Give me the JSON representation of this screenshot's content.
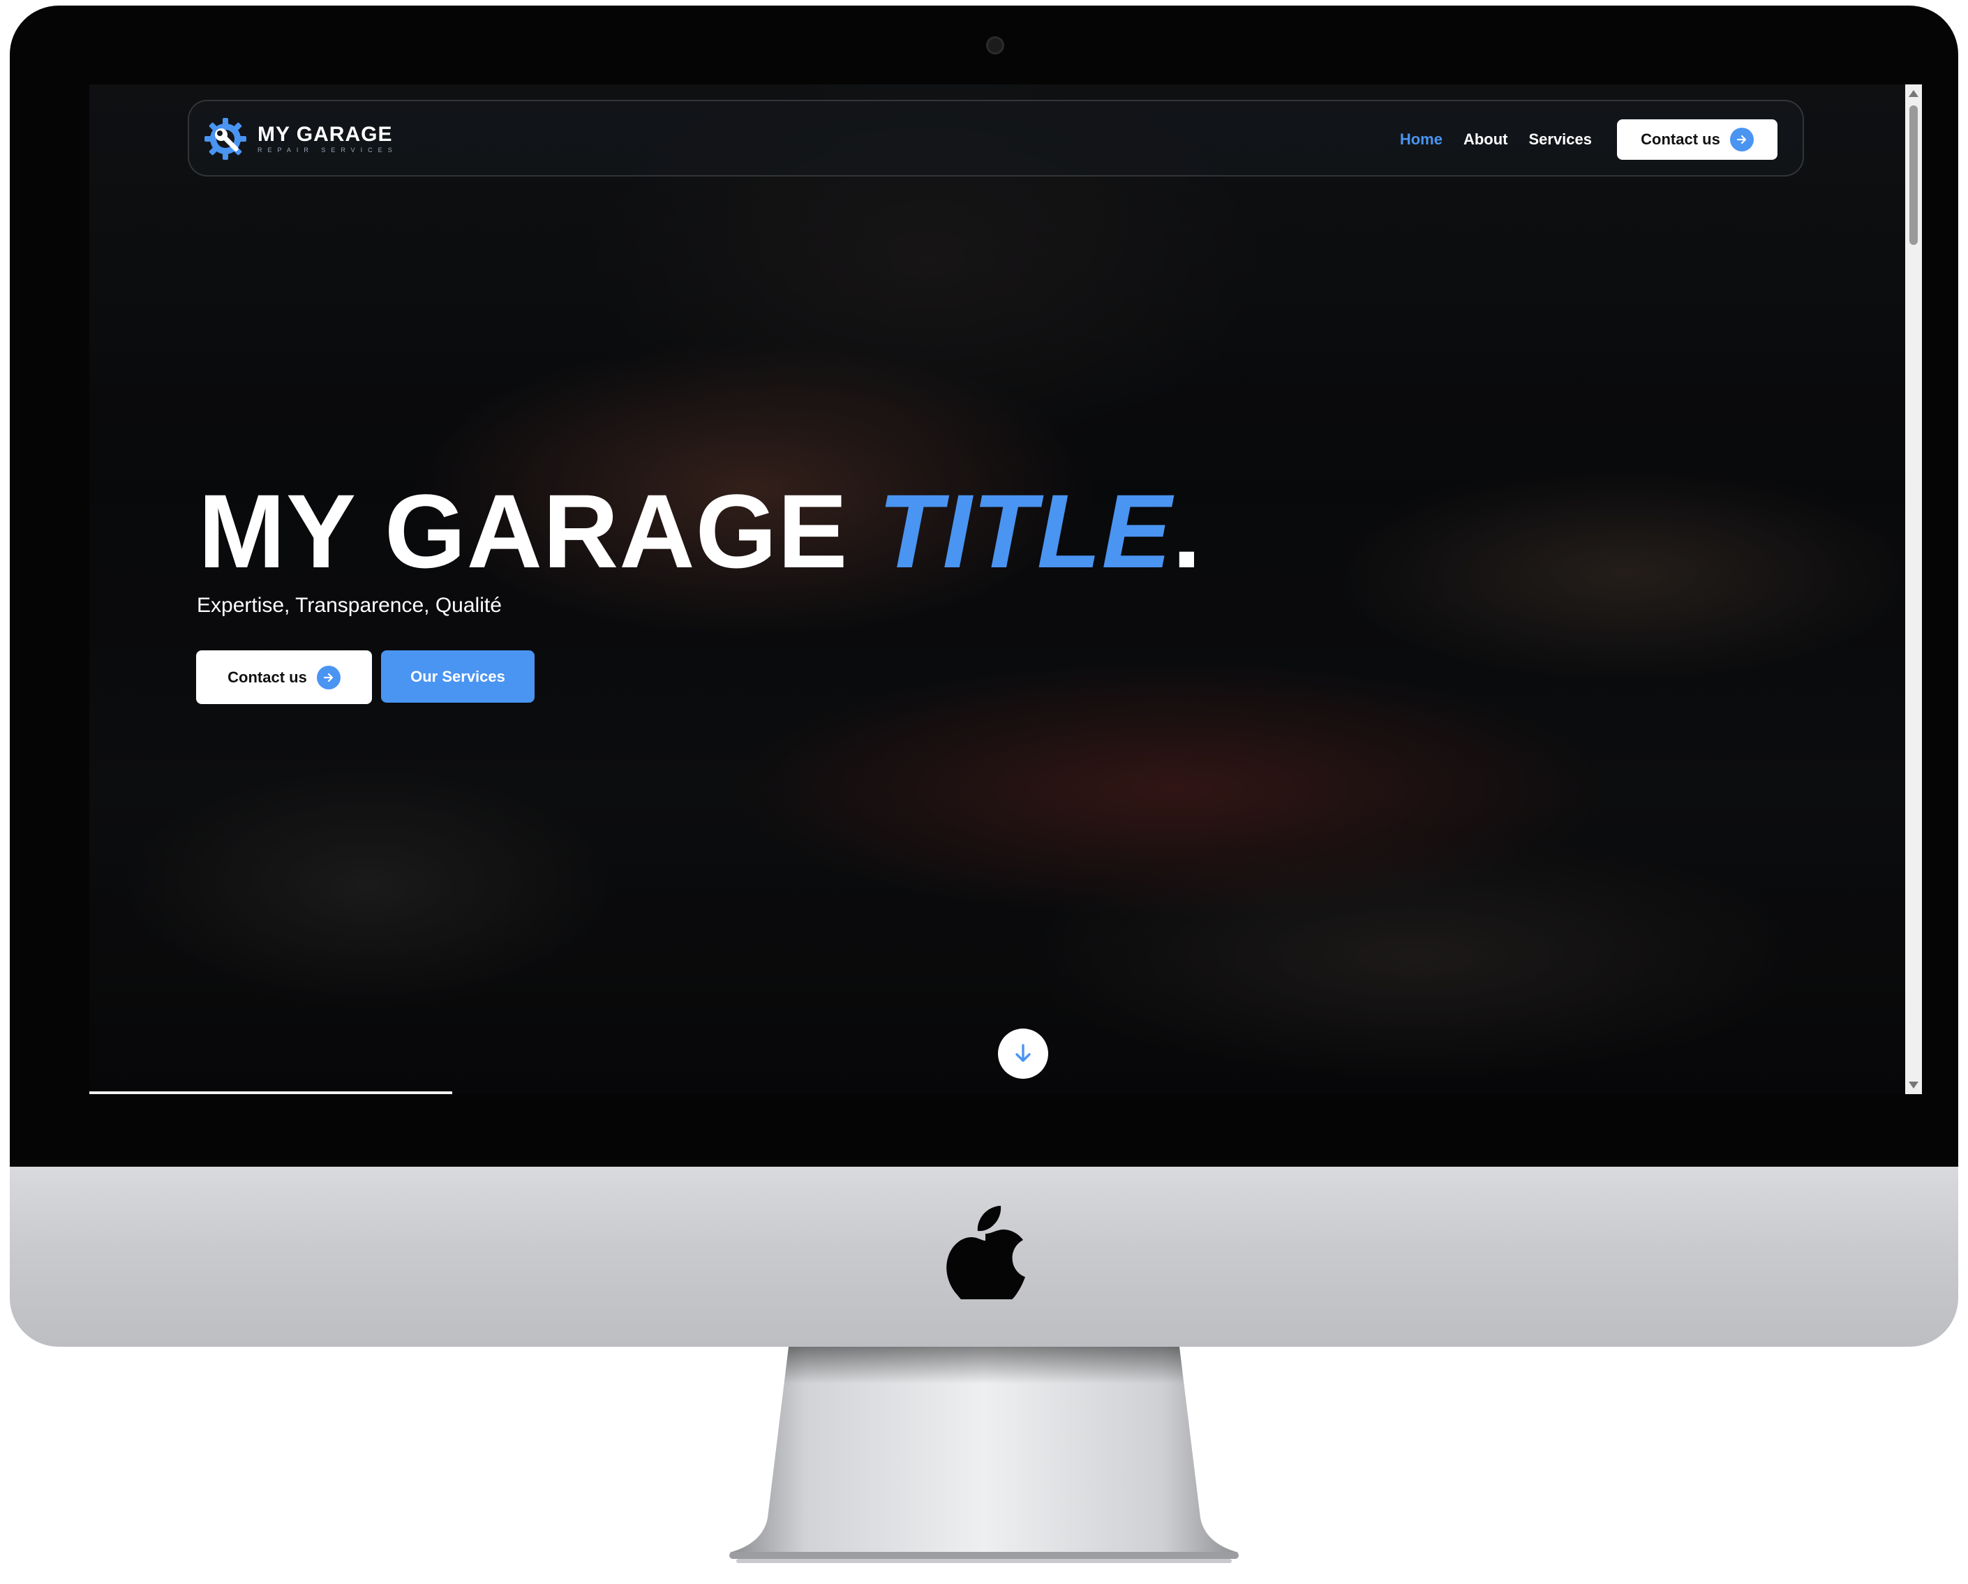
{
  "navbar": {
    "brand_name": "MY GARAGE",
    "brand_subtitle": "REPAIR SERVICES",
    "links": [
      "Home",
      "About",
      "Services"
    ],
    "active_link": "Home",
    "contact_label": "Contact us"
  },
  "hero": {
    "title_main": "MY GARAGE ",
    "title_accent": "TITLE",
    "title_end": ".",
    "subtitle": "Expertise, Transparence, Qualité",
    "contact_label": "Contact us",
    "services_label": "Our Services"
  },
  "icons": {
    "brand": "gear-wrench-icon",
    "arrow_right": "arrow-right-icon",
    "arrow_down": "arrow-down-icon",
    "device_logo": "apple-logo-icon"
  },
  "colors": {
    "accent": "#4a94f2",
    "button_bg": "#ffffff",
    "hero_dark": "#0a0b0e"
  },
  "page_scroll_progress": 0.2
}
